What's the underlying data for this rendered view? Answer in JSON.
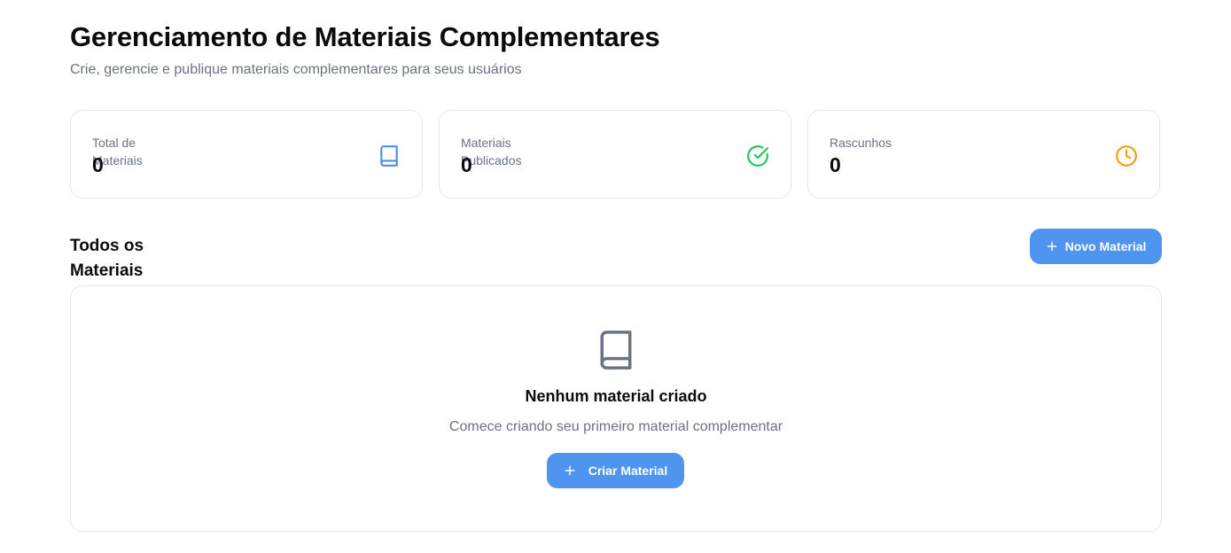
{
  "header": {
    "title": "Gerenciamento de Materiais Complementares",
    "subtitle": "Crie, gerencie e publique materiais complementares para seus usuários"
  },
  "stats": [
    {
      "label": "Total de Materiais",
      "value": "0",
      "icon": "book-icon",
      "color": "#4a90e2"
    },
    {
      "label": "Materiais Publicados",
      "value": "0",
      "icon": "check-circle-icon",
      "color": "#22c55e"
    },
    {
      "label": "Rascunhos",
      "value": "0",
      "icon": "clock-icon",
      "color": "#f59e0b"
    }
  ],
  "section": {
    "title": "Todos os Materiais",
    "new_button_label": "Novo Material"
  },
  "empty_state": {
    "icon": "book-icon",
    "title": "Nenhum material criado",
    "description": "Comece criando seu primeiro material complementar",
    "button_label": "Criar Material"
  },
  "colors": {
    "accent": "#4f94ef",
    "muted_text": "#6b7280",
    "border": "#e5e7eb"
  }
}
